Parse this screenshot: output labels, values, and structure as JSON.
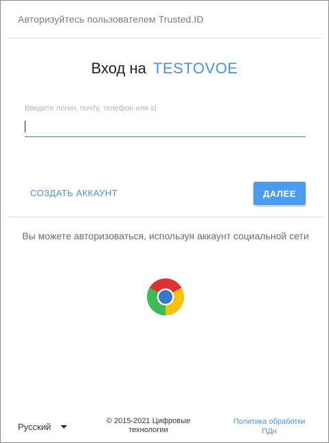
{
  "header": {
    "title": "Авторизуйтесь пользователем Trusted.ID"
  },
  "login": {
    "title_prefix": "Вход на",
    "app_name": "TESTOVOE",
    "field_label": "Введите логин, почту, телефон или id",
    "field_value": ""
  },
  "actions": {
    "create_account_label": "СОЗДАТЬ АККАУНТ",
    "next_label": "ДАЛЕЕ"
  },
  "social": {
    "text": "Вы можете авторизоваться, используя аккаунт социальной сети",
    "providers": [
      {
        "icon": "chrome-icon"
      }
    ]
  },
  "footer": {
    "language": "Русский",
    "copyright_line1": "© 2015-2021 Цифровые",
    "copyright_line2": "технологии",
    "policy_line1": "Политика обработки",
    "policy_line2": "ПДн"
  },
  "colors": {
    "accent": "#4a90e2",
    "button": "#4a9cf0",
    "input_underline": "#2e7fd6"
  }
}
